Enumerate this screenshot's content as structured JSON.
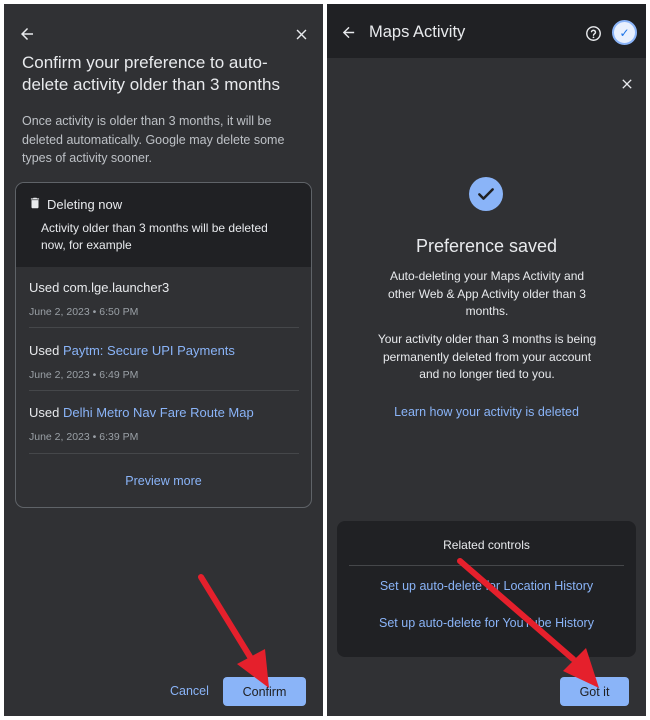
{
  "left": {
    "title": "Confirm your preference to auto-delete activity older than 3 months",
    "description": "Once activity is older than 3 months, it will be deleted automatically. Google may delete some types of activity sooner.",
    "card": {
      "header_title": "Deleting now",
      "header_desc": "Activity older than 3 months will be deleted now, for example",
      "items": [
        {
          "prefix": "Used com.lge.launcher3",
          "link": "",
          "date": "June 2, 2023 • 6:50 PM"
        },
        {
          "prefix": "Used ",
          "link": "Paytm: Secure UPI Payments",
          "date": "June 2, 2023 • 6:49 PM"
        },
        {
          "prefix": "Used ",
          "link": "Delhi Metro Nav Fare Route Map",
          "date": "June 2, 2023 • 6:39 PM"
        }
      ],
      "preview_more": "Preview more"
    },
    "cancel_label": "Cancel",
    "confirm_label": "Confirm"
  },
  "right": {
    "app_title": "Maps Activity",
    "heading": "Preference saved",
    "para1": "Auto-deleting your Maps Activity and other Web & App Activity older than 3 months.",
    "para2": "Your activity older than 3 months is being permanently deleted from your account and no longer tied to you.",
    "learn_link": "Learn how your activity is deleted",
    "related": {
      "title": "Related controls",
      "links": [
        "Set up auto-delete for Location History",
        "Set up auto-delete for YouTube History"
      ]
    },
    "got_it_label": "Got it"
  },
  "icons": {
    "back": "arrow-back-icon",
    "close": "close-icon",
    "trash": "trash-icon",
    "help": "help-icon",
    "check": "check-icon",
    "annotation": "red-arrow-icon"
  },
  "colors": {
    "surface": "#303134",
    "surface_dark": "#202124",
    "accent": "#8ab4f8",
    "annotation": "#e5202c"
  }
}
